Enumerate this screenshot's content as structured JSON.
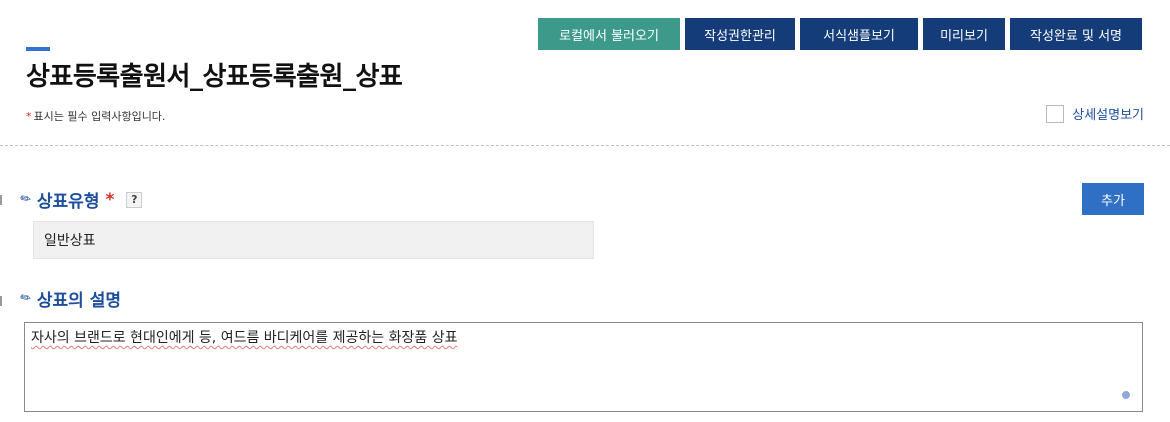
{
  "toolbar": {
    "load_local": "로컬에서 불러오기",
    "permission": "작성권한관리",
    "sample": "서식샘플보기",
    "preview": "미리보기",
    "complete_sign": "작성완료 및 서명"
  },
  "page": {
    "title": "상표등록출원서_상표등록출원_상표",
    "required_note_star": "*",
    "required_note": "표시는 필수 입력사항입니다.",
    "detail_view_label": "상세설명보기"
  },
  "trademark_type": {
    "title": "상표유형",
    "required": "*",
    "help": "?",
    "add_button": "추가",
    "value": "일반상표"
  },
  "trademark_description": {
    "title": "상표의 설명",
    "value": "자사의 브랜드로 현대인에게 등, 여드름 바디케어를 제공하는 화장품 상표"
  },
  "colors": {
    "teal_button": "#3d9a8b",
    "navy_button": "#143c78",
    "blue_accent": "#1c4e9c",
    "add_button": "#2f6fc4",
    "required": "#d92b2b"
  }
}
